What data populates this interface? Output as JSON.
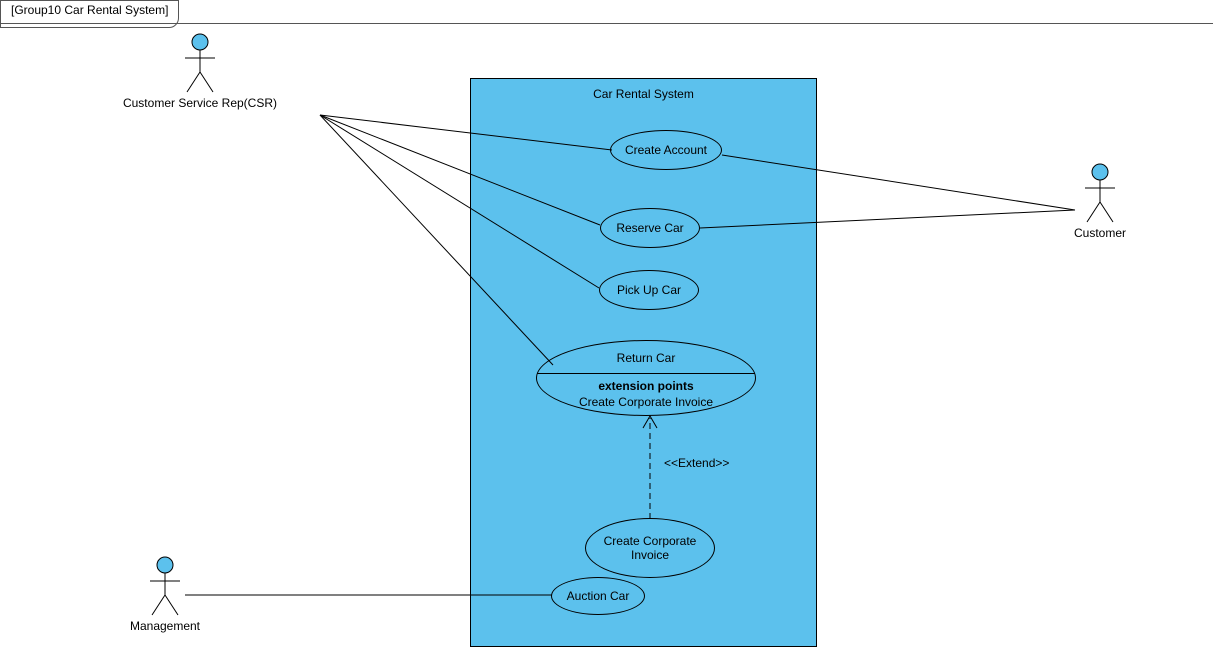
{
  "frame": {
    "title": "[Group10 Car Rental System]"
  },
  "system": {
    "title": "Car Rental System"
  },
  "actors": {
    "csr": {
      "label": "Customer Service Rep(CSR)"
    },
    "customer": {
      "label": "Customer"
    },
    "management": {
      "label": "Management"
    }
  },
  "usecases": {
    "createAccount": {
      "label": "Create Account"
    },
    "reserveCar": {
      "label": "Reserve Car"
    },
    "pickUpCar": {
      "label": "Pick Up Car"
    },
    "returnCar": {
      "label": "Return Car",
      "extTitle": "extension points",
      "extPoint": "Create Corporate Invoice"
    },
    "createCorpInvoice": {
      "label1": "Create Corporate",
      "label2": "Invoice"
    },
    "auctionCar": {
      "label": "Auction Car"
    }
  },
  "relations": {
    "extendLabel": "<<Extend>>"
  }
}
